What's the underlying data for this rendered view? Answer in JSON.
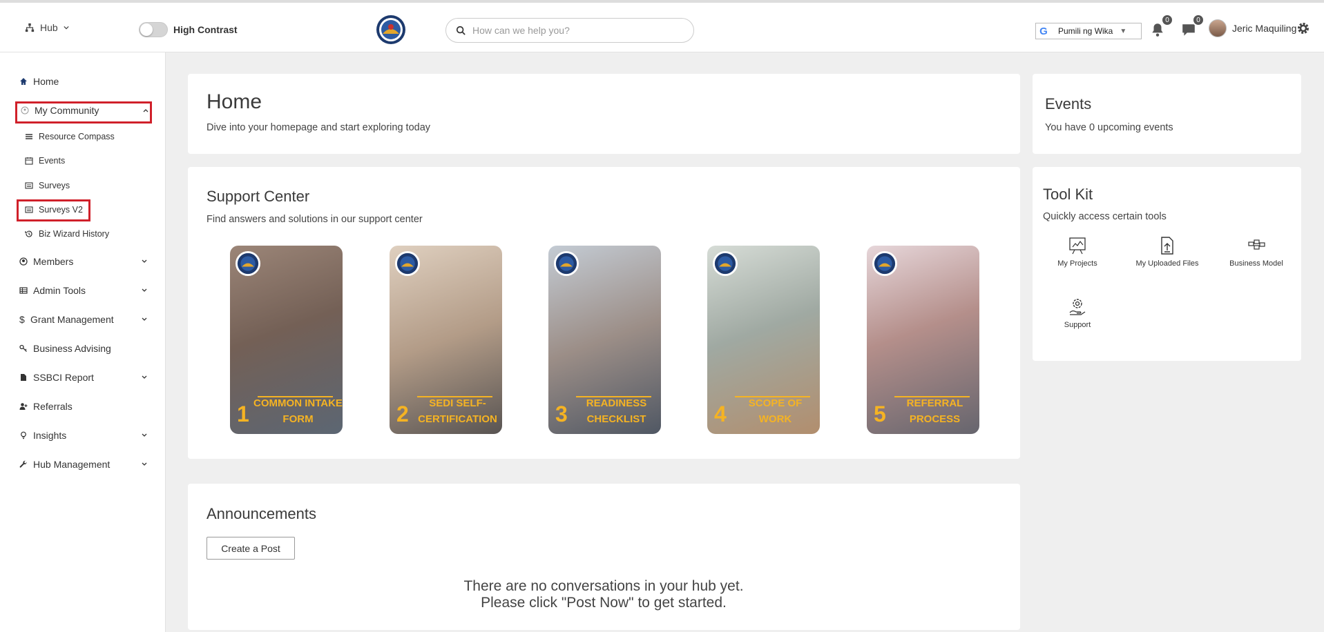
{
  "header": {
    "hub_label": "Hub",
    "contrast_label": "High Contrast",
    "search_placeholder": "How can we help you?",
    "language_label": "Pumili ng Wika",
    "notifications_count": "0",
    "messages_count": "0",
    "user_name": "Jeric Maquiling"
  },
  "sidebar": {
    "items": [
      {
        "label": "Home",
        "icon": "home-icon"
      },
      {
        "label": "My Community",
        "icon": "community-icon",
        "expanded": true
      },
      {
        "label": "Resource Compass",
        "icon": "list-icon"
      },
      {
        "label": "Events",
        "icon": "calendar-icon"
      },
      {
        "label": "Surveys",
        "icon": "survey-icon"
      },
      {
        "label": "Surveys V2",
        "icon": "survey-icon"
      },
      {
        "label": "Biz Wizard History",
        "icon": "history-icon"
      },
      {
        "label": "Members",
        "icon": "user-circle-icon"
      },
      {
        "label": "Admin Tools",
        "icon": "table-icon"
      },
      {
        "label": "Grant Management",
        "icon": "dollar-icon"
      },
      {
        "label": "Business Advising",
        "icon": "key-icon"
      },
      {
        "label": "SSBCI Report",
        "icon": "file-icon"
      },
      {
        "label": "Referrals",
        "icon": "user-plus-icon"
      },
      {
        "label": "Insights",
        "icon": "lightbulb-icon"
      },
      {
        "label": "Hub Management",
        "icon": "wrench-icon"
      }
    ]
  },
  "home": {
    "title": "Home",
    "subtitle": "Dive into your homepage and start exploring today"
  },
  "support": {
    "title": "Support Center",
    "subtitle": "Find answers and solutions in our support center",
    "tiles": [
      {
        "number": "1",
        "caption": "COMMON INTAKE FORM"
      },
      {
        "number": "2",
        "caption": "SEDI SELF-CERTIFICATION"
      },
      {
        "number": "3",
        "caption": "READINESS CHECKLIST"
      },
      {
        "number": "4",
        "caption": "SCOPE OF WORK"
      },
      {
        "number": "5",
        "caption": "REFERRAL PROCESS"
      }
    ]
  },
  "announcements": {
    "title": "Announcements",
    "button": "Create a Post",
    "empty_line1": "There are no conversations in your hub yet.",
    "empty_line2": "Please click \"Post Now\" to get started."
  },
  "events": {
    "title": "Events",
    "subtitle": "You have 0 upcoming events"
  },
  "toolkit": {
    "title": "Tool Kit",
    "subtitle": "Quickly access certain tools",
    "tools": [
      {
        "label": "My Projects",
        "icon": "projects-icon"
      },
      {
        "label": "My Uploaded Files",
        "icon": "file-upload-icon"
      },
      {
        "label": "Business Model",
        "icon": "business-model-icon"
      },
      {
        "label": "Support",
        "icon": "support-icon"
      }
    ]
  },
  "colors": {
    "highlight": "#d0202a",
    "tile_accent": "#f5b323"
  }
}
